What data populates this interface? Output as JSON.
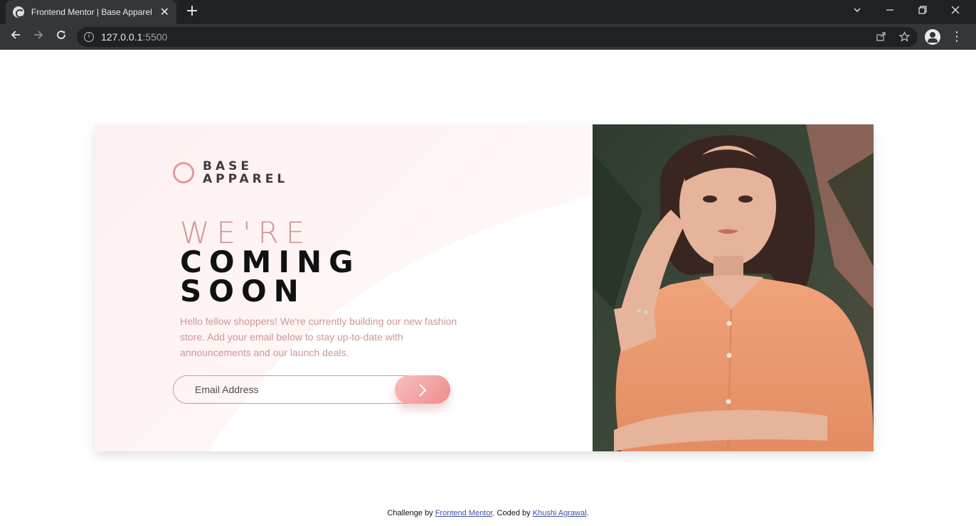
{
  "browser": {
    "tab_title": "Frontend Mentor | Base Apparel",
    "tab_close": "✕",
    "new_tab": "+",
    "url_host": "127.0.0.1",
    "url_port": ":5500",
    "icons": [
      "back-icon",
      "forward-icon",
      "reload-icon",
      "info-icon",
      "share-icon",
      "star-icon",
      "profile-icon",
      "menu-icon"
    ]
  },
  "page": {
    "logo_line1": "BASE",
    "logo_line2": "APPAREL",
    "headline_light": "WE'RE",
    "headline_dark_1": "COMING",
    "headline_dark_2": "SOON",
    "description": "Hello fellow shoppers! We're currently building our new fashion store. Add your email below to stay up-to-date with announcements and our launch deals.",
    "email_placeholder": "Email Address",
    "submit_icon": "›",
    "colors": {
      "accent": "#ce9797",
      "dark": "#423a3a",
      "button_from": "#f8bfbf",
      "button_to": "#ee8c8c"
    }
  },
  "footer": {
    "prefix": "Challenge by ",
    "link1": "Frontend Mentor",
    "middle": ". Coded by ",
    "link2": "Khushi Agrawal",
    "suffix": "."
  }
}
